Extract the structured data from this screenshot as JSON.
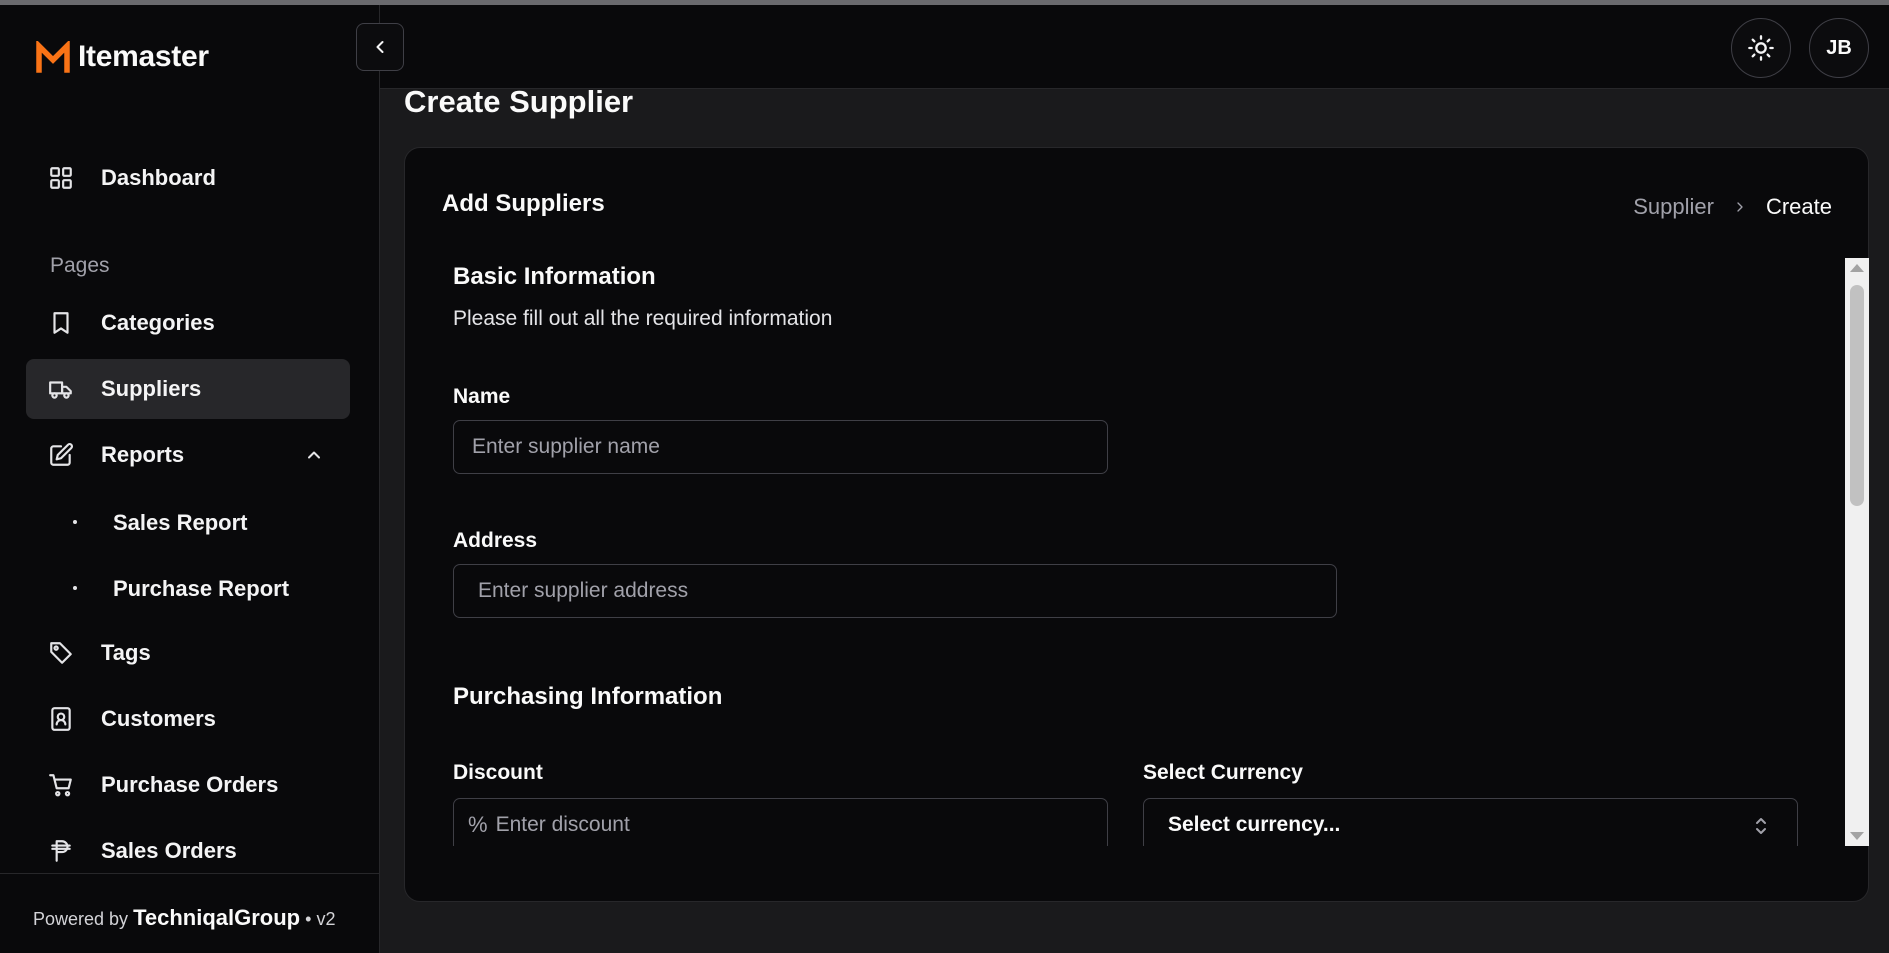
{
  "brand": {
    "name": "Itemaster",
    "logo_icon": "m-logo-icon",
    "accent": "#f97316"
  },
  "sidebar": {
    "dashboard": "Dashboard",
    "section_label": "Pages",
    "items": [
      {
        "label": "Categories",
        "icon": "bookmark-icon"
      },
      {
        "label": "Suppliers",
        "icon": "truck-icon",
        "active": true
      },
      {
        "label": "Reports",
        "icon": "edit-icon",
        "expanded": true
      },
      {
        "label": "Tags",
        "icon": "tag-icon"
      },
      {
        "label": "Customers",
        "icon": "contact-book-icon"
      },
      {
        "label": "Purchase Orders",
        "icon": "cart-icon"
      },
      {
        "label": "Sales Orders",
        "icon": "peso-icon"
      }
    ],
    "report_children": [
      "Sales Report",
      "Purchase Report"
    ],
    "footer": {
      "prefix": "Powered by",
      "company": "TechniqalGroup",
      "version": "• v2"
    }
  },
  "header": {
    "avatar_initials": "JB",
    "theme_icon": "sun-icon"
  },
  "page": {
    "title": "Create Supplier",
    "card_title": "Add Suppliers",
    "breadcrumb": {
      "parent": "Supplier",
      "current": "Create"
    }
  },
  "form": {
    "basic": {
      "title": "Basic Information",
      "description": "Please fill out all the required information",
      "name_label": "Name",
      "name_placeholder": "Enter supplier name",
      "address_label": "Address",
      "address_placeholder": "Enter supplier address"
    },
    "purchasing": {
      "title": "Purchasing Information",
      "discount_label": "Discount",
      "discount_placeholder": "Enter discount",
      "discount_prefix": "%",
      "currency_label": "Select Currency",
      "currency_value": "Select currency..."
    }
  }
}
